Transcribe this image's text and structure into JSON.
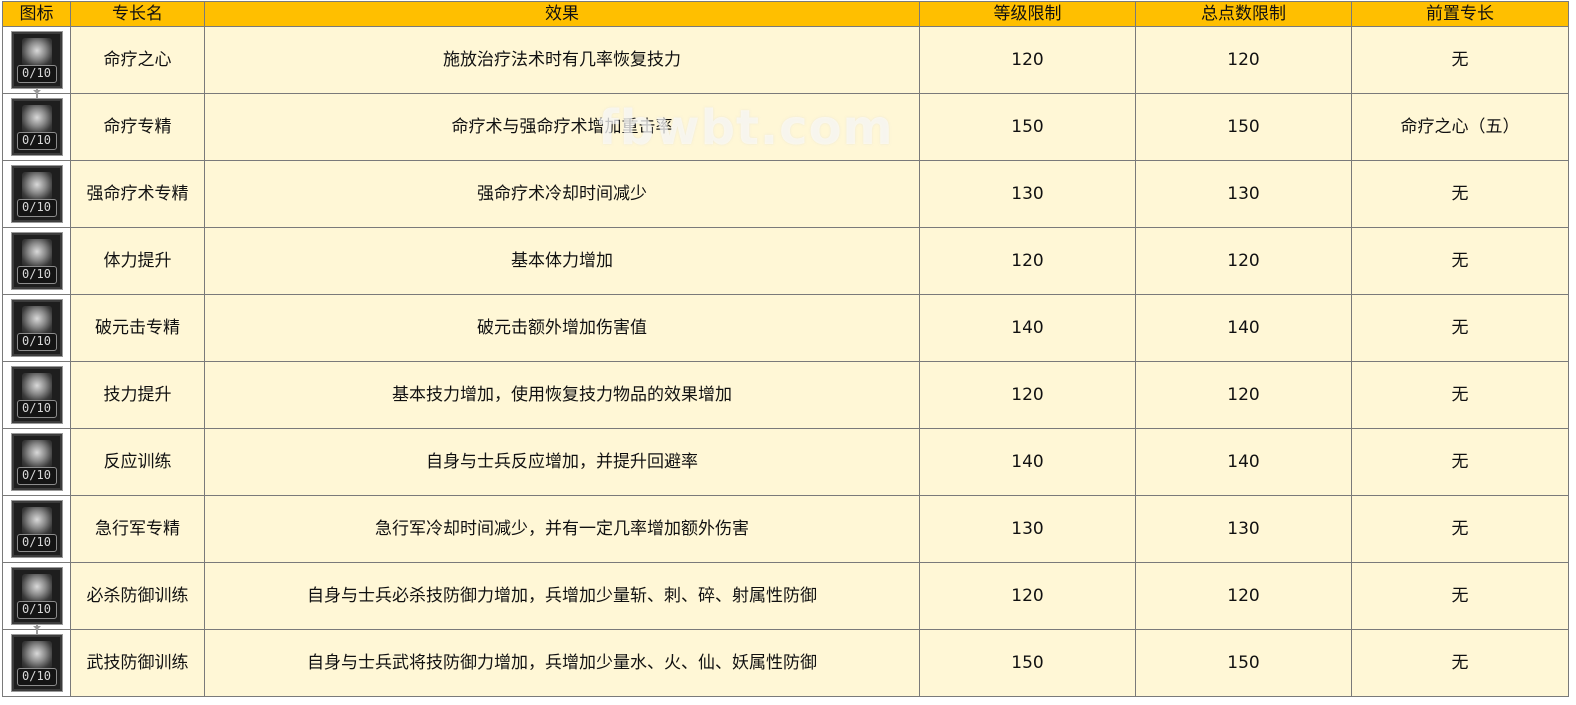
{
  "table": {
    "headers": {
      "icon": "图标",
      "name": "专长名",
      "effect": "效果",
      "level_limit": "等级限制",
      "total_points_limit": "总点数限制",
      "prerequisite": "前置专长"
    },
    "rows": [
      {
        "icon": "heart-of-healing-icon",
        "level": "0/10",
        "name": "命疗之心",
        "effect": "施放治疗法术时有几率恢复技力",
        "level_limit": "120",
        "total_points_limit": "120",
        "prerequisite": "无"
      },
      {
        "icon": "healing-mastery-icon",
        "level": "0/10",
        "name": "命疗专精",
        "effect": "命疗术与强命疗术增加重击率",
        "level_limit": "150",
        "total_points_limit": "150",
        "prerequisite": "命疗之心（五）"
      },
      {
        "icon": "greater-healing-mastery-icon",
        "level": "0/10",
        "name": "强命疗术专精",
        "effect": "强命疗术冷却时间减少",
        "level_limit": "130",
        "total_points_limit": "130",
        "prerequisite": "无"
      },
      {
        "icon": "stamina-boost-icon",
        "level": "0/10",
        "name": "体力提升",
        "effect": "基本体力增加",
        "level_limit": "120",
        "total_points_limit": "120",
        "prerequisite": "无"
      },
      {
        "icon": "element-break-icon",
        "level": "0/10",
        "name": "破元击专精",
        "effect": "破元击额外增加伤害值",
        "level_limit": "140",
        "total_points_limit": "140",
        "prerequisite": "无"
      },
      {
        "icon": "skill-power-boost-icon",
        "level": "0/10",
        "name": "技力提升",
        "effect": "基本技力增加，使用恢复技力物品的效果增加",
        "level_limit": "120",
        "total_points_limit": "120",
        "prerequisite": "无"
      },
      {
        "icon": "reaction-training-icon",
        "level": "0/10",
        "name": "反应训练",
        "effect": "自身与士兵反应增加，并提升回避率",
        "level_limit": "140",
        "total_points_limit": "140",
        "prerequisite": "无"
      },
      {
        "icon": "forced-march-icon",
        "level": "0/10",
        "name": "急行军专精",
        "effect": "急行军冷却时间减少，并有一定几率增加额外伤害",
        "level_limit": "130",
        "total_points_limit": "130",
        "prerequisite": "无"
      },
      {
        "icon": "special-defense-training-icon",
        "level": "0/10",
        "name": "必杀防御训练",
        "effect": "自身与士兵必杀技防御力增加，兵增加少量斩、刺、碎、射属性防御",
        "level_limit": "120",
        "total_points_limit": "120",
        "prerequisite": "无"
      },
      {
        "icon": "martial-defense-training-icon",
        "level": "0/10",
        "name": "武技防御训练",
        "effect": "自身与士兵武将技防御力增加，兵增加少量水、火、仙、妖属性防御",
        "level_limit": "150",
        "total_points_limit": "150",
        "prerequisite": "无"
      }
    ]
  },
  "watermark": "fbwbt.com",
  "colors": {
    "header_bg": "#ffbf00",
    "row_bg": "#fff7d6",
    "border": "#7a7a7a"
  }
}
